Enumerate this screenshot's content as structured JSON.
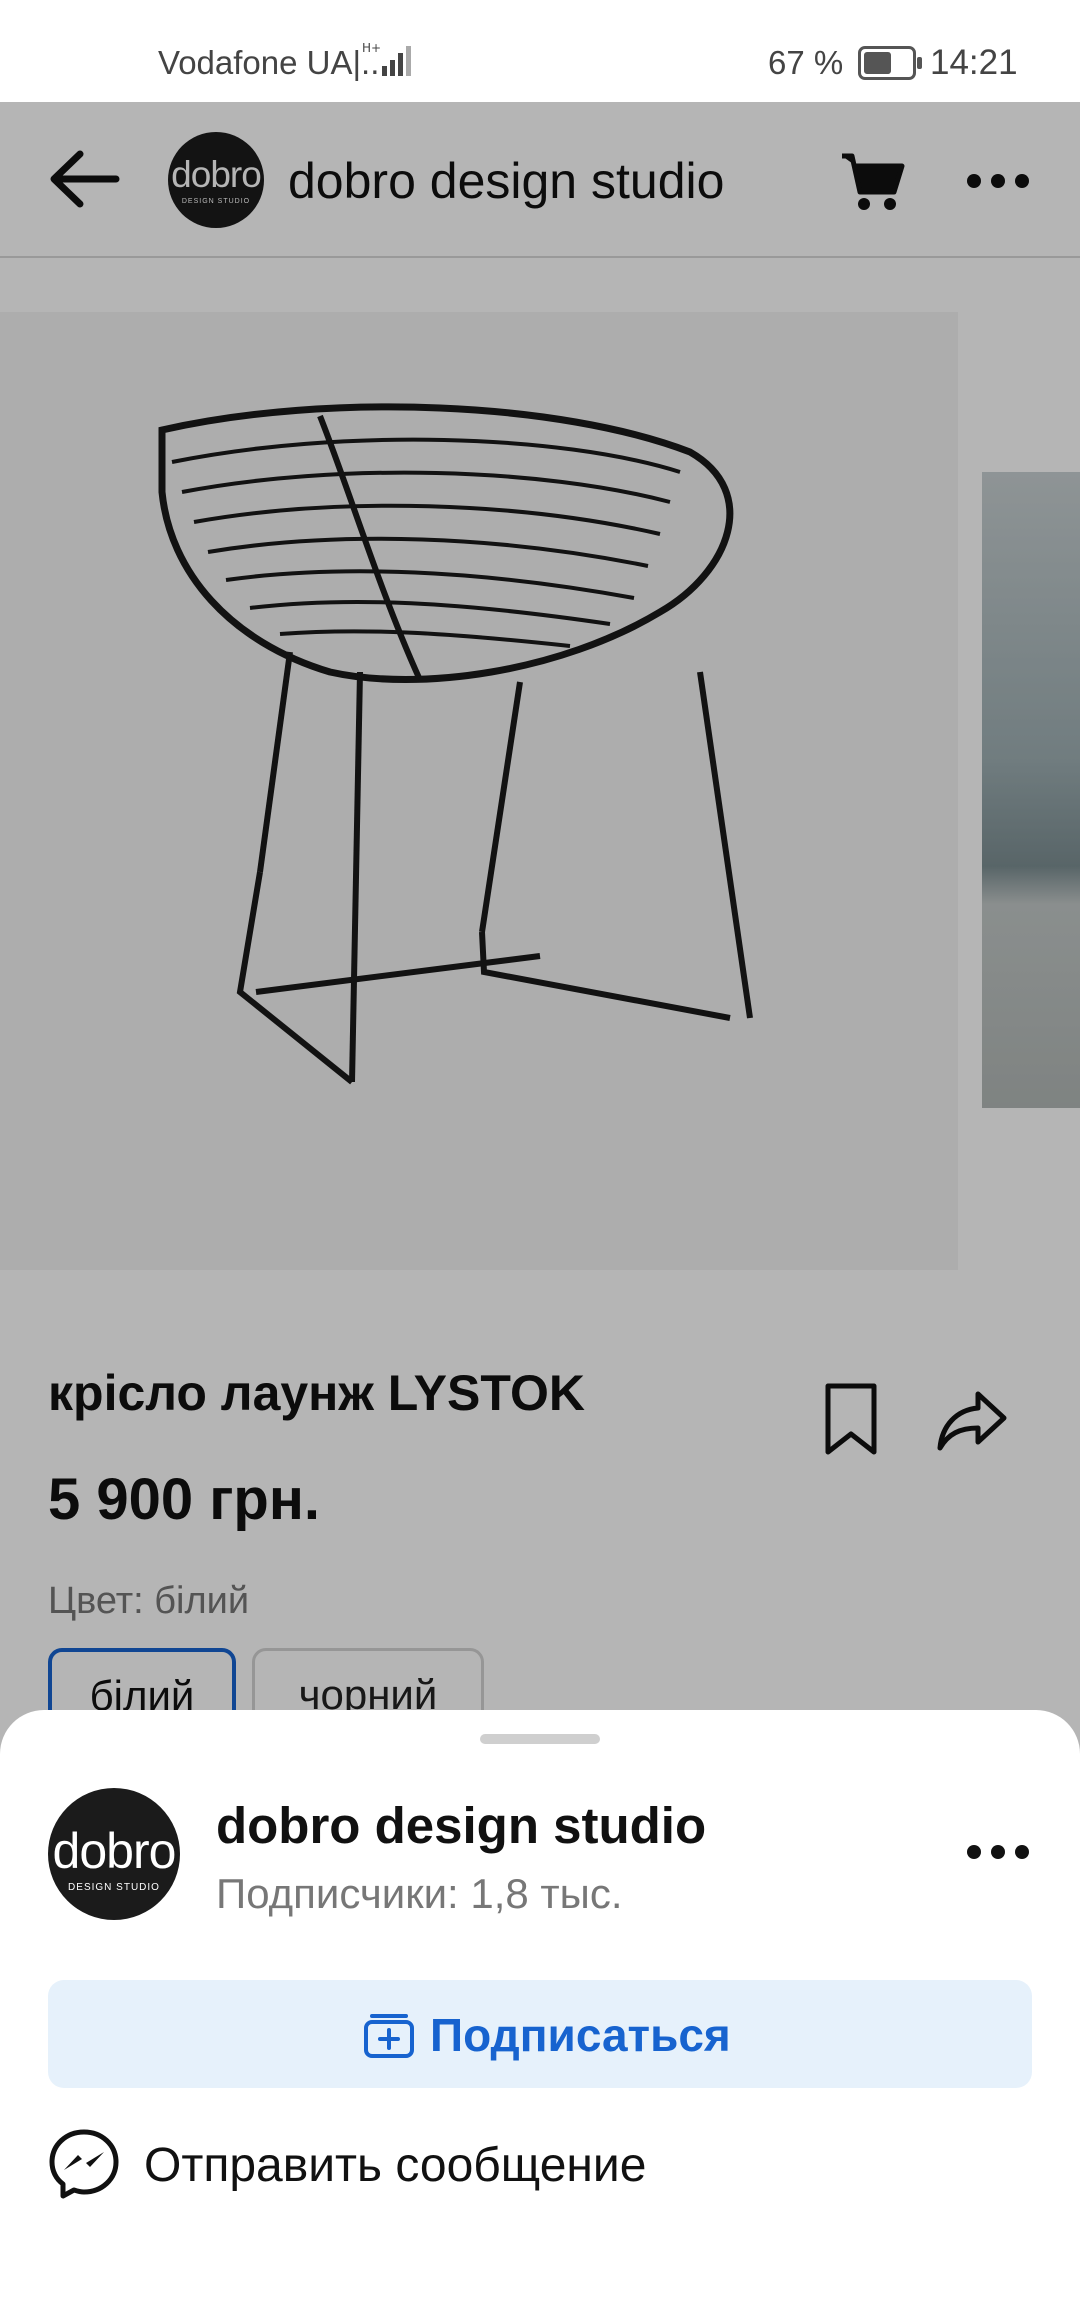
{
  "status_bar": {
    "carrier": "Vodafone UA|...",
    "battery": "67 %",
    "battery_level": 0.67,
    "time": "14:21"
  },
  "header": {
    "title": "dobro design studio",
    "avatar_text": "dobro",
    "avatar_subtext": "DESIGN STUDIO"
  },
  "product": {
    "name": "крісло лаунж LYSTOK",
    "price": "5 900 грн.",
    "color_line": "Цвет: білий",
    "swatches": [
      "білий",
      "чорний"
    ],
    "selected_swatch": "білий"
  },
  "sheet": {
    "title": "dobro design studio",
    "subscribers": "Подписчики: 1,8 тыс.",
    "avatar_text": "dobro",
    "avatar_subtext": "DESIGN STUDIO",
    "subscribe_label": "Подписаться",
    "message_label": "Отправить сообщение"
  },
  "colors": {
    "accent": "#1763cf",
    "subscribe_bg": "#e6f1fb",
    "overlay": "rgba(0,0,0,0.29)"
  }
}
